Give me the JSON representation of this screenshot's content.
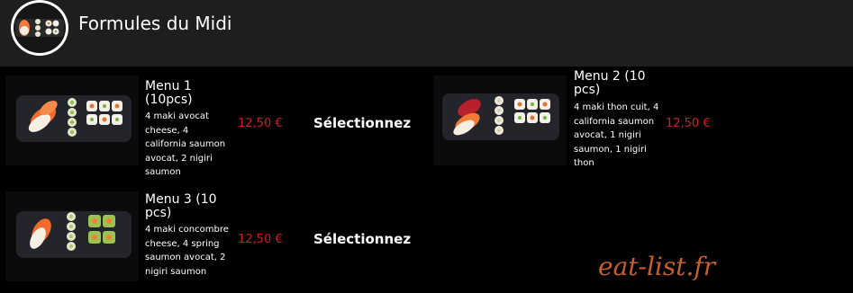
{
  "header": {
    "title": "Formules du Midi"
  },
  "menus": [
    {
      "title": "Menu 1 (10pcs)",
      "description": "4 maki avocat cheese, 4 california saumon avocat, 2 nigiri saumon",
      "price": "12,50 €",
      "select_label": "Sélectionnez"
    },
    {
      "title": "Menu 2 (10 pcs)",
      "description": "4 maki thon cuit, 4 california saumon avocat, 1 nigiri saumon, 1 nigiri thon",
      "price": "12,50 €",
      "select_label": ""
    },
    {
      "title": "Menu 3 (10 pcs)",
      "description": "4 maki concombre cheese, 4 spring saumon avocat, 2 nigiri saumon",
      "price": "12,50 €",
      "select_label": "Sélectionnez"
    }
  ],
  "watermark": "eat-list.fr"
}
